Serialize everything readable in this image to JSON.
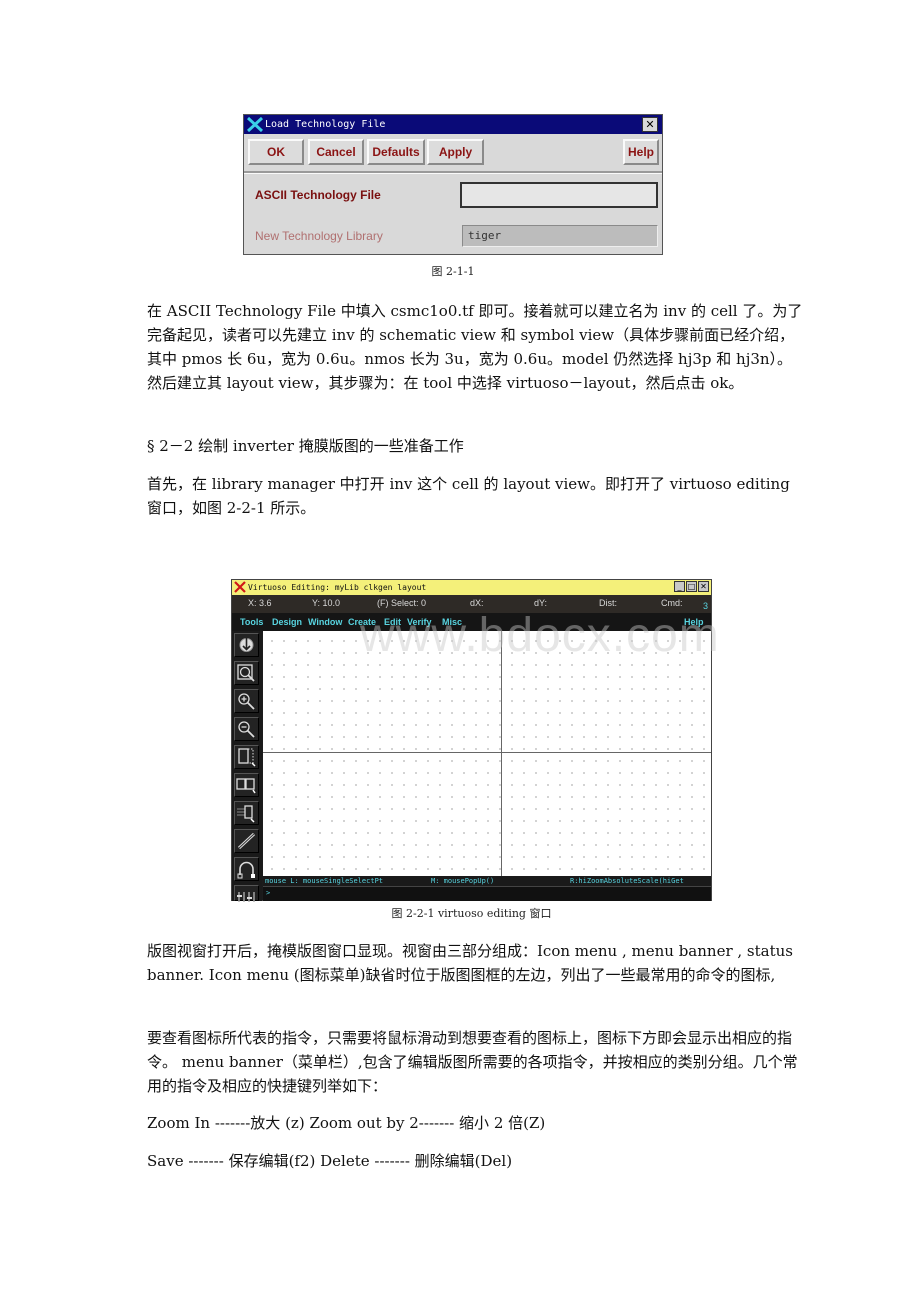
{
  "dialog": {
    "title": "Load Technology File",
    "buttons": {
      "ok": "OK",
      "cancel": "Cancel",
      "defaults": "Defaults",
      "apply": "Apply",
      "help": "Help"
    },
    "fields": [
      {
        "label": "ASCII Technology File",
        "value": ""
      },
      {
        "label": "New Technology Library",
        "value": "tiger",
        "disabled": true
      }
    ],
    "caption": "图 2-1-1"
  },
  "paragraphs": {
    "p1": "在 ASCII Technology File 中填入 csmc1o0.tf 即可。接着就可以建立名为 inv 的 cell 了。为了完备起见，读者可以先建立 inv 的 schematic view 和 symbol view（具体步骤前面已经介绍，其中 pmos 长 6u，宽为 0.6u。nmos 长为 3u，宽为 0.6u。model 仍然选择 hj3p 和 hj3n）。然后建立其 layout view，其步骤为：在 tool 中选择 virtuoso－layout，然后点击 ok。",
    "section": "§ 2－2 绘制 inverter 掩膜版图的一些准备工作",
    "p2": "首先，在 library manager 中打开 inv 这个 cell 的 layout view。即打开了 virtuoso editing 窗口，如图 2-2-1 所示。",
    "p3": "版图视窗打开后，掩模版图窗口显现。视窗由三部分组成：Icon menu , menu banner , status banner. Icon menu (图标菜单)缺省时位于版图图框的左边，列出了一些最常用的命令的图标,",
    "p4": "要查看图标所代表的指令，只需要将鼠标滑动到想要查看的图标上，图标下方即会显示出相应的指令。 menu banner（菜单栏）,包含了编辑版图所需要的各项指令，并按相应的类别分组。几个常用的指令及相应的快捷键列举如下：",
    "shortcut1": "Zoom In -------放大 (z) Zoom out by 2------- 缩小 2 倍(Z)",
    "shortcut2": "Save ------- 保存编辑(f2) Delete ------- 删除编辑(Del)"
  },
  "virtuoso": {
    "title": "Virtuoso Editing: myLib clkgen layout",
    "status": {
      "x": "X:  3.6",
      "y": "Y:  10.0",
      "select": "(F) Select: 0",
      "dx": "dX:",
      "dy": "dY:",
      "dist": "Dist:",
      "cmd": "Cmd:",
      "cmd_value": "3"
    },
    "menus": [
      "Tools",
      "Design",
      "Window",
      "Create",
      "Edit",
      "Verify",
      "Misc"
    ],
    "help": "Help",
    "icons": [
      "save-icon",
      "zoom-fit-icon",
      "zoom-in-icon",
      "zoom-out-icon",
      "stretch-icon",
      "copy-icon",
      "move-icon",
      "path-icon",
      "ruler-icon"
    ],
    "mouse": {
      "left": "mouse L: mouseSingleSelectPt",
      "middle": "M: mousePopUp()",
      "right": "R:hiZoomAbsoluteScale(hiGet"
    },
    "prompt": ">",
    "caption": "图 2-2-1    virtuoso editing 窗口"
  },
  "watermark": "www.bdocx.com",
  "colors": {
    "dialog_title": "#0a0a78",
    "virtuoso_title": "#f4f07a",
    "menu_text": "#58d4e0",
    "label_text": "#8b1414"
  }
}
